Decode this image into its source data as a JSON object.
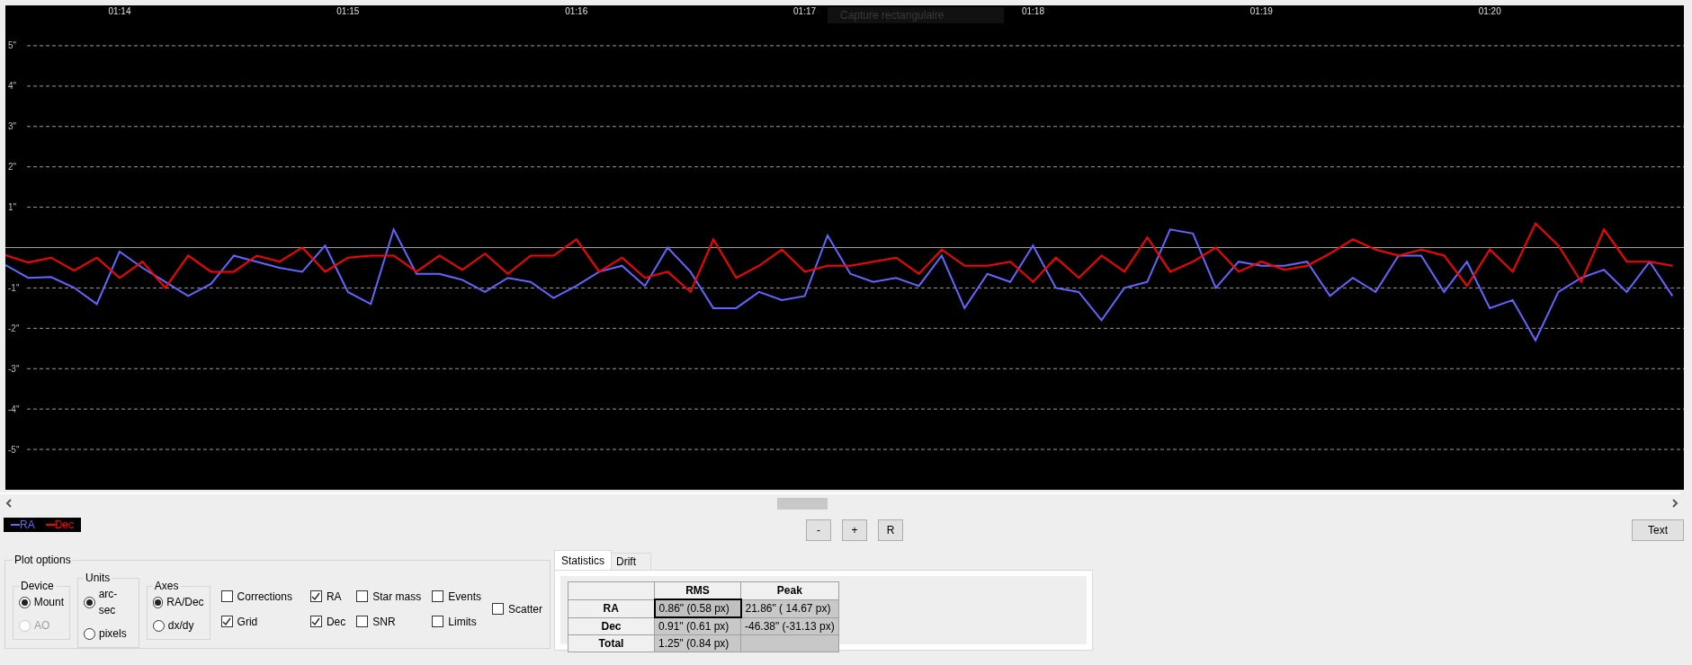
{
  "chart": {
    "overlay_tooltip": "Capture rectangulaire",
    "chart_data": {
      "type": "line",
      "grid": true,
      "xlim": [
        73.5,
        80.85
      ],
      "ylim": [
        -6,
        6
      ],
      "xticks": [
        {
          "value": 74,
          "label": "01:14"
        },
        {
          "value": 75,
          "label": "01:15"
        },
        {
          "value": 76,
          "label": "01:16"
        },
        {
          "value": 77,
          "label": "01:17"
        },
        {
          "value": 78,
          "label": "01:18"
        },
        {
          "value": 79,
          "label": "01:19"
        },
        {
          "value": 80,
          "label": "01:20"
        }
      ],
      "yticks": [
        {
          "value": 5,
          "label": "5\""
        },
        {
          "value": 4,
          "label": "4\""
        },
        {
          "value": 3,
          "label": "3\""
        },
        {
          "value": 2,
          "label": "2\""
        },
        {
          "value": 1,
          "label": "1\""
        },
        {
          "value": -1,
          "label": "-1\""
        },
        {
          "value": -2,
          "label": "-2\""
        },
        {
          "value": -3,
          "label": "-3\""
        },
        {
          "value": -4,
          "label": "-4\""
        },
        {
          "value": -5,
          "label": "-5\""
        }
      ],
      "x": [
        73.5,
        73.6,
        73.7,
        73.8,
        73.9,
        74.0,
        74.1,
        74.2,
        74.3,
        74.4,
        74.5,
        74.6,
        74.7,
        74.8,
        74.9,
        75.0,
        75.1,
        75.2,
        75.3,
        75.4,
        75.5,
        75.6,
        75.7,
        75.8,
        75.9,
        76.0,
        76.1,
        76.2,
        76.3,
        76.4,
        76.5,
        76.6,
        76.7,
        76.8,
        76.9,
        77.0,
        77.1,
        77.2,
        77.3,
        77.4,
        77.5,
        77.6,
        77.7,
        77.8,
        77.9,
        78.0,
        78.1,
        78.2,
        78.3,
        78.4,
        78.5,
        78.6,
        78.7,
        78.8,
        78.9,
        79.0,
        79.1,
        79.2,
        79.3,
        79.4,
        79.5,
        79.6,
        79.7,
        79.8,
        79.9,
        80.0,
        80.1,
        80.2,
        80.3,
        80.4,
        80.5,
        80.6,
        80.7,
        80.8
      ],
      "series": [
        {
          "name": "RA",
          "color": "#6464ff",
          "values": [
            -0.43,
            -0.75,
            -0.73,
            -0.99,
            -1.4,
            -0.1,
            -0.5,
            -0.85,
            -1.2,
            -0.9,
            -0.2,
            -0.35,
            -0.5,
            -0.6,
            0.05,
            -1.1,
            -1.4,
            0.45,
            -0.65,
            -0.65,
            -0.8,
            -1.1,
            -0.75,
            -0.85,
            -1.25,
            -0.95,
            -0.6,
            -0.45,
            -0.95,
            0.0,
            -0.6,
            -1.5,
            -1.5,
            -1.1,
            -1.3,
            -1.2,
            0.3,
            -0.65,
            -0.85,
            -0.75,
            -0.95,
            -0.2,
            -1.5,
            -0.65,
            -0.85,
            0.05,
            -1.0,
            -1.1,
            -1.8,
            -1.0,
            -0.85,
            0.45,
            0.35,
            -1.0,
            -0.35,
            -0.45,
            -0.45,
            -0.35,
            -1.2,
            -0.75,
            -1.1,
            -0.2,
            -0.2,
            -1.1,
            -0.35,
            -1.5,
            -1.3,
            -2.3,
            -1.1,
            -0.75,
            -0.55,
            -1.1,
            -0.35,
            -1.2
          ]
        },
        {
          "name": "Dec",
          "color": "#ff0000",
          "values": [
            -0.19,
            -0.37,
            -0.25,
            -0.57,
            -0.25,
            -0.75,
            -0.35,
            -1.0,
            -0.2,
            -0.6,
            -0.6,
            -0.2,
            -0.35,
            0.0,
            -0.6,
            -0.25,
            -0.2,
            -0.2,
            -0.6,
            -0.2,
            -0.55,
            -0.15,
            -0.65,
            -0.2,
            -0.2,
            0.2,
            -0.6,
            -0.25,
            -0.75,
            -0.6,
            -1.1,
            0.2,
            -0.75,
            -0.45,
            -0.05,
            -0.6,
            -0.45,
            -0.45,
            -0.35,
            -0.25,
            -0.65,
            -0.05,
            -0.45,
            -0.45,
            -0.35,
            -0.85,
            -0.25,
            -0.75,
            -0.2,
            -0.6,
            0.25,
            -0.6,
            -0.35,
            0.0,
            -0.6,
            -0.35,
            -0.55,
            -0.45,
            -0.15,
            0.2,
            -0.05,
            -0.2,
            -0.05,
            -0.2,
            -0.95,
            -0.05,
            -0.6,
            0.6,
            0.05,
            -0.85,
            0.45,
            -0.35,
            -0.35,
            -0.45
          ]
        }
      ]
    }
  },
  "zoom_buttons": [
    "-",
    "+",
    "R"
  ],
  "text_button": "Text",
  "plot_options": {
    "title": "Plot options",
    "radio_groups": [
      {
        "title": "Device",
        "options": [
          {
            "label": "Mount",
            "selected": true,
            "disabled": false
          },
          {
            "label": "AO",
            "selected": false,
            "disabled": true
          }
        ]
      },
      {
        "title": "Units",
        "options": [
          {
            "label": "arc-sec",
            "selected": true,
            "disabled": false
          },
          {
            "label": "pixels",
            "selected": false,
            "disabled": false
          }
        ]
      },
      {
        "title": "Axes",
        "options": [
          {
            "label": "RA/Dec",
            "selected": true,
            "disabled": false
          },
          {
            "label": "dx/dy",
            "selected": false,
            "disabled": false
          }
        ]
      }
    ],
    "checkbox_columns": [
      [
        {
          "label": "Corrections",
          "checked": false
        },
        {
          "label": "Grid",
          "checked": true
        }
      ],
      [
        {
          "label": "RA",
          "checked": true
        },
        {
          "label": "Dec",
          "checked": true
        }
      ],
      [
        {
          "label": "Star mass",
          "checked": false
        },
        {
          "label": "SNR",
          "checked": false
        }
      ],
      [
        {
          "label": "Events",
          "checked": false
        },
        {
          "label": "Limits",
          "checked": false
        }
      ],
      [
        {
          "label": "Scatter",
          "checked": false
        }
      ]
    ]
  },
  "stats": {
    "tabs": [
      {
        "label": "Statistics",
        "selected": true
      },
      {
        "label": "Drift",
        "selected": false
      }
    ],
    "columns": [
      "RMS",
      "Peak"
    ],
    "rows": [
      {
        "header": "RA",
        "cells": [
          {
            "text": "0.86\" (0.58 px)",
            "selected": true
          },
          {
            "text": "21.86\" ( 14.67 px)",
            "selected": false
          }
        ]
      },
      {
        "header": "Dec",
        "cells": [
          {
            "text": "0.91\" (0.61 px)",
            "selected": false
          },
          {
            "text": "-46.38\" (-31.13 px)",
            "selected": false
          }
        ]
      },
      {
        "header": "Total",
        "cells": [
          {
            "text": "1.25\" (0.84 px)",
            "selected": false
          }
        ]
      }
    ]
  }
}
